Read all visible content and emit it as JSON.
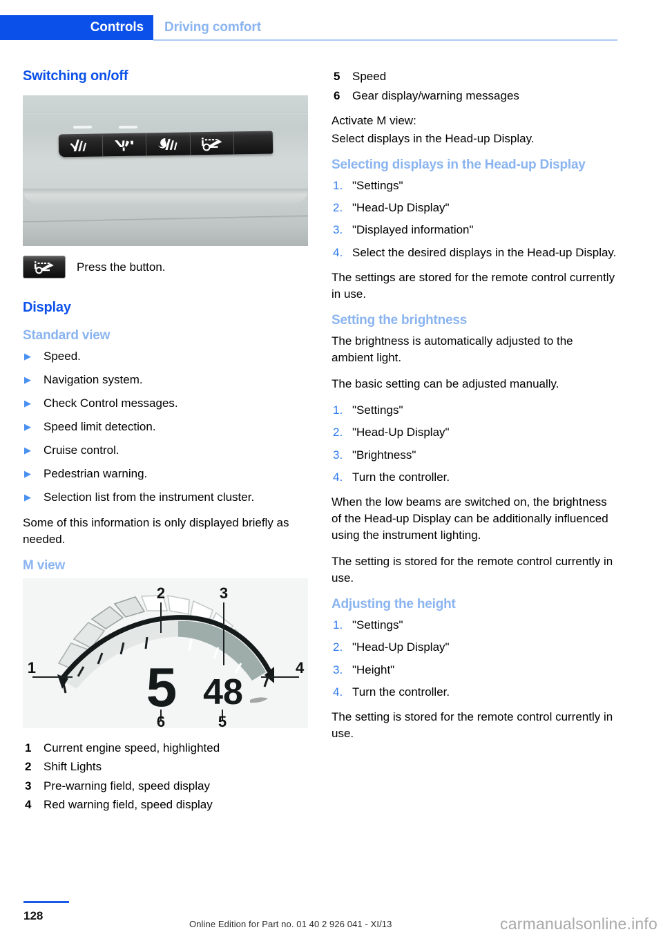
{
  "header": {
    "active_tab": "Controls",
    "inactive_tab": "Driving comfort",
    "accent_color": "#0b50e8",
    "muted_accent_color": "#8ab4f0"
  },
  "left_column": {
    "switching_heading": "Switching on/off",
    "dashboard_figure": {
      "alt": "Dashboard button strip with four driver-assistance buttons",
      "buttons": [
        "lane-departure-warning-icon",
        "high-beam-assistant-icon",
        "night-vision-icon",
        "head-up-display-icon"
      ]
    },
    "press_instruction": "Press the button.",
    "press_icon": "head-up-display-icon",
    "display_heading": "Display",
    "standard_view_heading": "Standard view",
    "standard_view_items": [
      "Speed.",
      "Navigation system.",
      "Check Control messages.",
      "Speed limit detection.",
      "Cruise control.",
      "Pedestrian warning.",
      "Selection list from the instrument cluster."
    ],
    "standard_view_note": "Some of this information is only displayed briefly as needed.",
    "m_view_heading": "M view",
    "m_view_figure": {
      "alt": "M view head-up display gauge",
      "gear_value": "5",
      "speed_value": "48",
      "callouts": [
        "1",
        "2",
        "3",
        "4",
        "5",
        "6"
      ]
    },
    "m_view_legend": [
      {
        "num": "1",
        "text": "Current engine speed, highlighted"
      },
      {
        "num": "2",
        "text": "Shift Lights"
      },
      {
        "num": "3",
        "text": "Pre-warning field, speed display"
      },
      {
        "num": "4",
        "text": "Red warning field, speed display"
      }
    ]
  },
  "right_column": {
    "legend_continued": [
      {
        "num": "5",
        "text": "Speed"
      },
      {
        "num": "6",
        "text": "Gear display/warning messages"
      }
    ],
    "activate_label": "Activate M view:",
    "activate_text": "Select displays in the Head-up Display.",
    "selecting_heading": "Selecting displays in the Head-up Display",
    "selecting_steps": [
      "\"Settings\"",
      "\"Head-Up Display\"",
      "\"Displayed information\"",
      "Select the desired displays in the Head-up Display."
    ],
    "selecting_note": "The settings are stored for the remote control currently in use.",
    "brightness_heading": "Setting the brightness",
    "brightness_intro_1": "The brightness is automatically adjusted to the ambient light.",
    "brightness_intro_2": "The basic setting can be adjusted manually.",
    "brightness_steps": [
      "\"Settings\"",
      "\"Head-Up Display\"",
      "\"Brightness\"",
      "Turn the controller."
    ],
    "brightness_note_1": "When the low beams are switched on, the brightness of the Head-up Display can be ad­ditionally influenced using the instrument light­ing.",
    "brightness_note_2": "The setting is stored for the remote control currently in use.",
    "height_heading": "Adjusting the height",
    "height_steps": [
      "\"Settings\"",
      "\"Head-Up Display\"",
      "\"Height\"",
      "Turn the controller."
    ],
    "height_note": "The setting is stored for the remote control currently in use."
  },
  "footer": {
    "page_number": "128",
    "edition_note": "Online Edition for Part no. 01 40 2 926 041 - XI/13",
    "watermark": "carmanualsonline.info"
  }
}
